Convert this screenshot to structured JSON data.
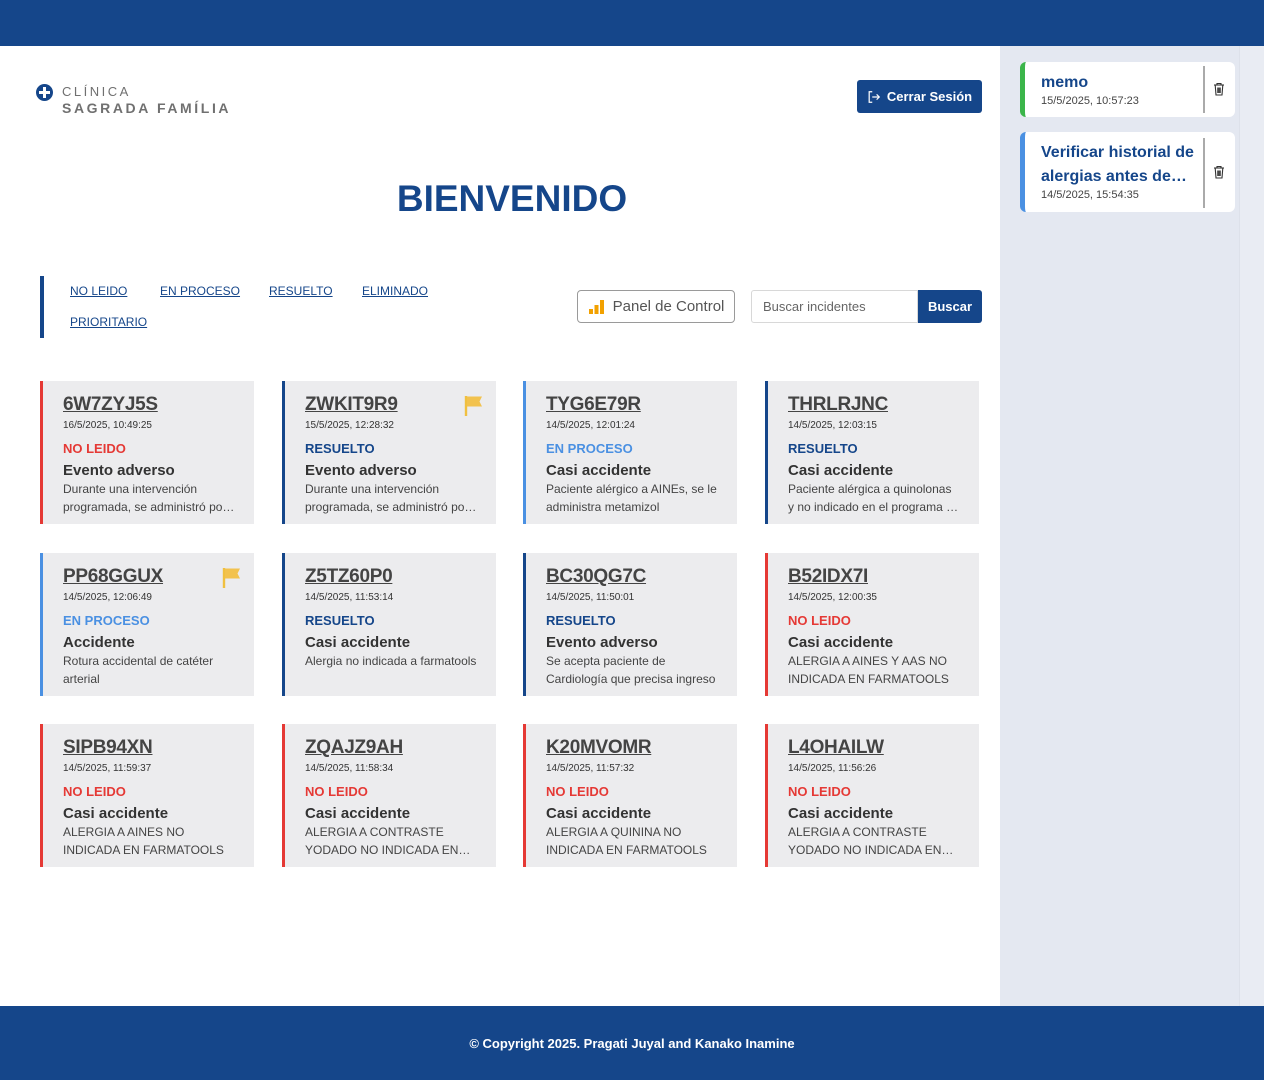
{
  "brand": {
    "line1": "CLÍNICA",
    "line2": "SAGRADA FAMÍLIA",
    "color": "#15468a"
  },
  "header": {
    "logout_label": "Cerrar Sesión",
    "welcome": "BIENVENIDO"
  },
  "filters": [
    {
      "label": "NO LEIDO"
    },
    {
      "label": "EN PROCESO"
    },
    {
      "label": "RESUELTO"
    },
    {
      "label": "ELIMINADO"
    },
    {
      "label": "PRIORITARIO"
    }
  ],
  "toolbar": {
    "panel_label": "Panel de Control",
    "search_placeholder": "Buscar incidentes",
    "search_value": "",
    "search_button": "Buscar"
  },
  "status_colors": {
    "NO LEIDO": "#e53935",
    "EN PROCESO": "#4a90e2",
    "RESUELTO": "#15468a"
  },
  "incidents": [
    {
      "id": "6W7ZYJ5S",
      "date": "16/5/2025, 10:49:25",
      "status": "NO LEIDO",
      "type": "Evento adverso",
      "desc": "Durante una intervención programada, se administró por error",
      "flag": false
    },
    {
      "id": "ZWKIT9R9",
      "date": "15/5/2025, 12:28:32",
      "status": "RESUELTO",
      "type": "Evento adverso",
      "desc": "Durante una intervención programada, se administró por error",
      "flag": true
    },
    {
      "id": "TYG6E79R",
      "date": "14/5/2025, 12:01:24",
      "status": "EN PROCESO",
      "type": "Casi accidente",
      "desc": "Paciente alérgico a AINEs, se le administra metamizol",
      "flag": false
    },
    {
      "id": "THRLRJNC",
      "date": "14/5/2025, 12:03:15",
      "status": "RESUELTO",
      "type": "Casi accidente",
      "desc": "Paciente alérgica a quinolonas y no indicado en el programa de farmacia",
      "flag": false
    },
    {
      "id": "PP68GGUX",
      "date": "14/5/2025, 12:06:49",
      "status": "EN PROCESO",
      "type": "Accidente",
      "desc": "Rotura accidental de catéter arterial",
      "flag": true
    },
    {
      "id": "Z5TZ60P0",
      "date": "14/5/2025, 11:53:14",
      "status": "RESUELTO",
      "type": "Casi accidente",
      "desc": "Alergia no indicada a farmatools",
      "flag": false
    },
    {
      "id": "BC30QG7C",
      "date": "14/5/2025, 11:50:01",
      "status": "RESUELTO",
      "type": "Evento adverso",
      "desc": "Se acepta paciente de Cardiología que precisa ingreso",
      "flag": false
    },
    {
      "id": "B52IDX7I",
      "date": "14/5/2025, 12:00:35",
      "status": "NO LEIDO",
      "type": "Casi accidente",
      "desc": "ALERGIA A AINES Y AAS NO INDICADA EN FARMATOOLS",
      "flag": false
    },
    {
      "id": "SIPB94XN",
      "date": "14/5/2025, 11:59:37",
      "status": "NO LEIDO",
      "type": "Casi accidente",
      "desc": "ALERGIA A AINES NO INDICADA EN FARMATOOLS",
      "flag": false
    },
    {
      "id": "ZQAJZ9AH",
      "date": "14/5/2025, 11:58:34",
      "status": "NO LEIDO",
      "type": "Casi accidente",
      "desc": "ALERGIA A CONTRASTE YODADO NO INDICADA EN FARMATOOLS",
      "flag": false
    },
    {
      "id": "K20MVOMR",
      "date": "14/5/2025, 11:57:32",
      "status": "NO LEIDO",
      "type": "Casi accidente",
      "desc": "ALERGIA A QUININA NO INDICADA EN FARMATOOLS",
      "flag": false
    },
    {
      "id": "L4OHAILW",
      "date": "14/5/2025, 11:56:26",
      "status": "NO LEIDO",
      "type": "Casi accidente",
      "desc": "ALERGIA A CONTRASTE YODADO NO INDICADA EN FARMATOOLS",
      "flag": false
    }
  ],
  "notes": [
    {
      "title": "memo",
      "date": "15/5/2025, 10:57:23",
      "accent": "#3bb54a"
    },
    {
      "title": "Verificar historial de alergias antes de…",
      "date": "14/5/2025, 15:54:35",
      "accent": "#4a90e2"
    }
  ],
  "footer": {
    "text": "© Copyright 2025. Pragati Juyal and Kanako Inamine"
  }
}
